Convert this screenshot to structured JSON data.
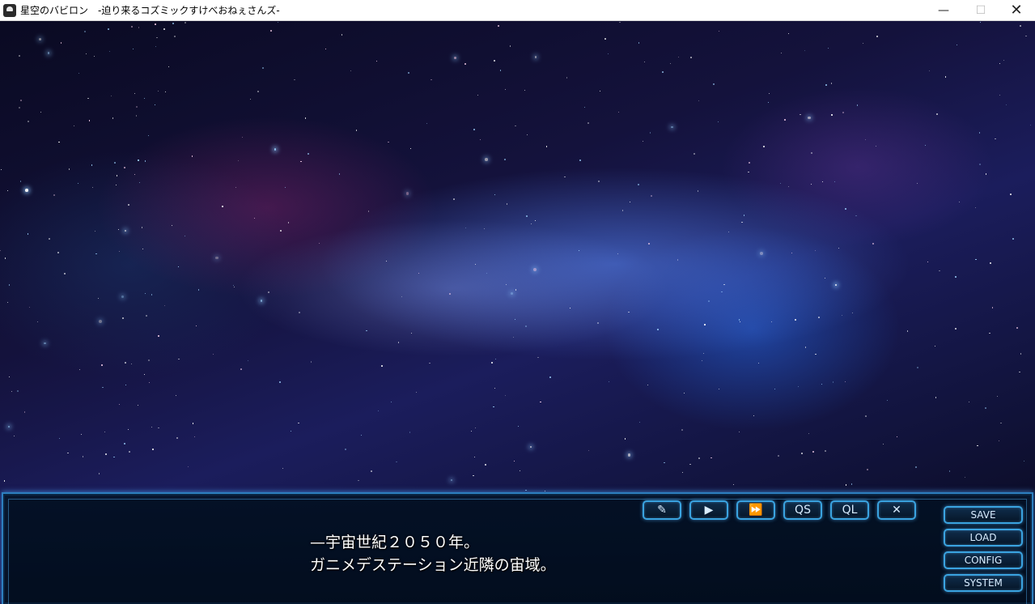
{
  "window": {
    "title": "星空のバビロン　-迫り来るコズミックすけべおねぇさんズ-",
    "minimize_glyph": "—",
    "maximize_glyph": "☐",
    "close_glyph": "✕"
  },
  "message": {
    "line1": "—宇宙世紀２０５０年。",
    "line2": "ガニメデステーション近隣の宙域。"
  },
  "quick_controls": [
    {
      "name": "backlog",
      "icon": "backlog-icon",
      "glyph": "✎"
    },
    {
      "name": "auto",
      "icon": "play-icon",
      "glyph": "▶"
    },
    {
      "name": "skip",
      "icon": "fast-forward-icon",
      "glyph": "⏩"
    },
    {
      "name": "quick-save",
      "label": "QS"
    },
    {
      "name": "quick-load",
      "label": "QL"
    },
    {
      "name": "hide-window",
      "icon": "close-icon",
      "glyph": "✕"
    }
  ],
  "menu": {
    "save": "SAVE",
    "load": "LOAD",
    "config": "CONFIG",
    "system": "SYSTEM"
  },
  "colors": {
    "accent": "#3aa3e0",
    "message_bg": "#061628",
    "text": "#ffffff"
  }
}
